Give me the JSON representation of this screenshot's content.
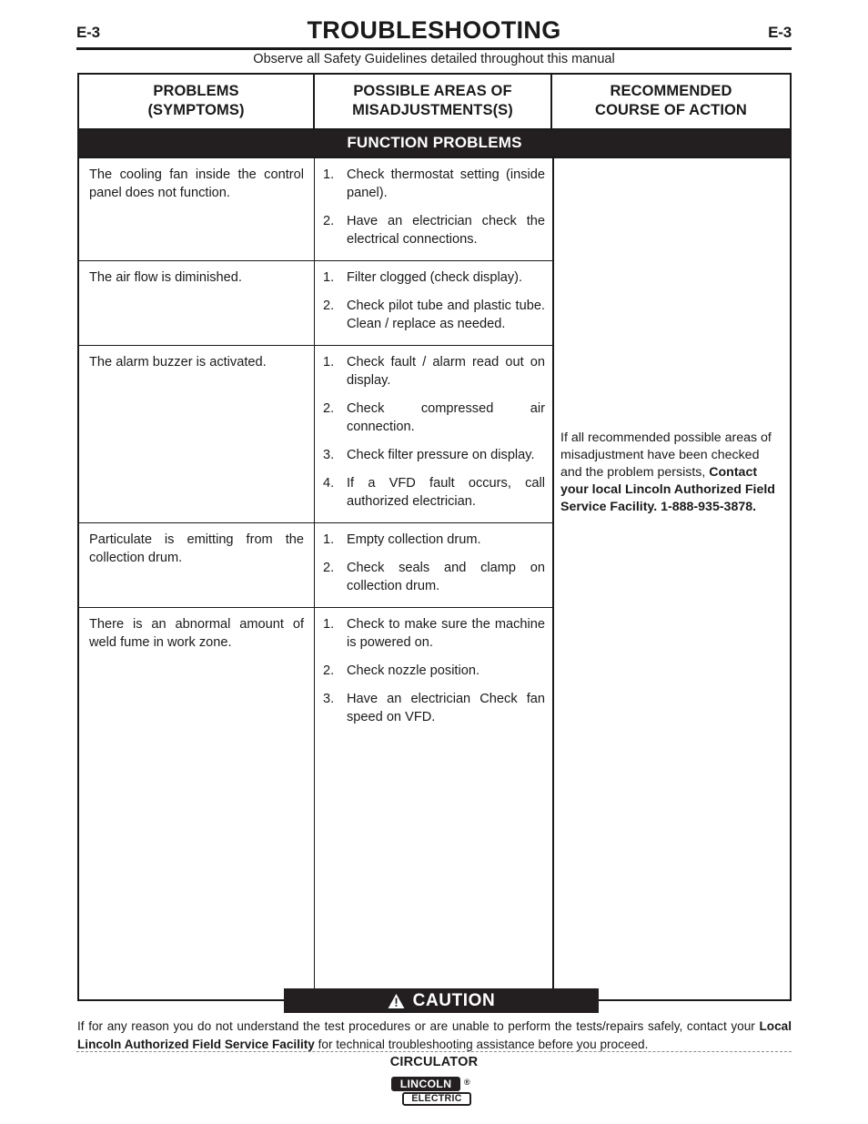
{
  "page": {
    "number_left": "E-3",
    "number_right": "E-3",
    "title": "TROUBLESHOOTING",
    "observe_note": "Observe all Safety Guidelines detailed throughout this manual"
  },
  "table": {
    "headers": {
      "col1_line1": "PROBLEMS",
      "col1_line2": "(SYMPTOMS)",
      "col2_line1": "POSSIBLE AREAS OF",
      "col2_line2": "MISADJUSTMENTS(S)",
      "col3_line1": "RECOMMENDED",
      "col3_line2": "COURSE OF ACTION"
    },
    "section_band": "FUNCTION PROBLEMS",
    "rows": [
      {
        "symptom": "The cooling fan inside the control panel does not function.",
        "areas": [
          {
            "num": "1.",
            "text": "Check thermostat setting (inside panel)."
          },
          {
            "num": "2.",
            "text": "Have an electrician check the electrical connections."
          }
        ]
      },
      {
        "symptom": "The air flow is diminished.",
        "areas": [
          {
            "num": "1.",
            "text": "Filter clogged (check display)."
          },
          {
            "num": "2.",
            "text": "Check pilot tube and plastic tube.  Clean / replace as needed."
          }
        ]
      },
      {
        "symptom": "The alarm buzzer is activated.",
        "areas": [
          {
            "num": "1.",
            "text": "Check fault / alarm read out on display."
          },
          {
            "num": "2.",
            "text": "Check compressed air connection."
          },
          {
            "num": "3.",
            "text": "Check filter pressure on display."
          },
          {
            "num": "4.",
            "text": "If a VFD fault occurs, call authorized electrician."
          }
        ]
      },
      {
        "symptom": "Particulate is emitting from the collection drum.",
        "areas": [
          {
            "num": "1.",
            "text": "Empty collection drum."
          },
          {
            "num": "2.",
            "text": "Check seals and clamp on collection drum."
          }
        ]
      },
      {
        "symptom": "There is an abnormal amount of weld fume in work zone.",
        "areas": [
          {
            "num": "1.",
            "text": "Check to make sure the machine is powered on."
          },
          {
            "num": "2.",
            "text": "Check nozzle position."
          },
          {
            "num": "3.",
            "text": "Have an electrician Check fan speed on VFD."
          }
        ]
      }
    ],
    "action": {
      "part_plain": "If all recommended possible areas of misadjustment have been checked and the problem persists, ",
      "part_bold": "Contact your local Lincoln Authorized Field Service Facility.  1-888-935-3878."
    }
  },
  "caution": {
    "label": "CAUTION",
    "icon": "warning-triangle-icon",
    "body_plain_1": "If for any reason you do not understand the test procedures or are unable to perform the tests/repairs safely, contact your ",
    "body_bold": "Local  Lincoln Authorized Field Service Facility",
    "body_plain_2": " for technical troubleshooting assistance before you proceed."
  },
  "footer": {
    "model": "CIRCULATOR",
    "logo_top": "LINCOLN",
    "logo_reg": "®",
    "logo_bottom": "ELECTRIC"
  }
}
